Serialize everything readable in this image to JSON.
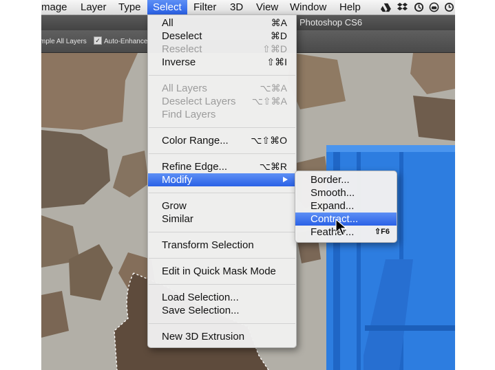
{
  "menubar": {
    "items": [
      "mage",
      "Layer",
      "Type",
      "Select",
      "Filter",
      "3D",
      "View",
      "Window",
      "Help"
    ],
    "active": "Select",
    "status_icons": [
      "google-drive-icon",
      "dropbox-icon",
      "sync-icon",
      "creative-cloud-icon",
      "time-machine-icon"
    ]
  },
  "app": {
    "title": "Photoshop CS6"
  },
  "options_bar": {
    "sample_all_layers": "mple All Layers",
    "auto_enhance": "Auto-Enhance",
    "checked": "✓"
  },
  "select_menu": {
    "items": [
      {
        "label": "All",
        "shortcut": "⌘A"
      },
      {
        "label": "Deselect",
        "shortcut": "⌘D"
      },
      {
        "label": "Reselect",
        "shortcut": "⇧⌘D",
        "disabled": true
      },
      {
        "label": "Inverse",
        "shortcut": "⇧⌘I"
      },
      {
        "label": "All Layers",
        "shortcut": "⌥⌘A",
        "disabled": true
      },
      {
        "label": "Deselect Layers",
        "shortcut": "⌥⇧⌘A",
        "disabled": true
      },
      {
        "label": "Find Layers",
        "shortcut": "",
        "disabled": true
      },
      {
        "label": "Color Range...",
        "shortcut": "⌥⇧⌘O"
      },
      {
        "label": "Refine Edge...",
        "shortcut": "⌥⌘R"
      },
      {
        "label": "Modify",
        "shortcut": "",
        "submenu": true
      },
      {
        "label": "Grow",
        "shortcut": ""
      },
      {
        "label": "Similar",
        "shortcut": ""
      },
      {
        "label": "Transform Selection",
        "shortcut": ""
      },
      {
        "label": "Edit in Quick Mask Mode",
        "shortcut": ""
      },
      {
        "label": "Load Selection...",
        "shortcut": ""
      },
      {
        "label": "Save Selection...",
        "shortcut": ""
      },
      {
        "label": "New 3D Extrusion",
        "shortcut": ""
      }
    ]
  },
  "modify_submenu": {
    "items": [
      {
        "label": "Border...",
        "shortcut": ""
      },
      {
        "label": "Smooth...",
        "shortcut": ""
      },
      {
        "label": "Expand...",
        "shortcut": ""
      },
      {
        "label": "Contract...",
        "shortcut": ""
      },
      {
        "label": "Feather...",
        "shortcut": "⇧F6"
      }
    ],
    "highlighted": "Contract..."
  },
  "colors": {
    "menu_highlight": "#2a61e6",
    "shutter_blue": "#2f7fe0",
    "mortar": "#b3b0a8"
  }
}
